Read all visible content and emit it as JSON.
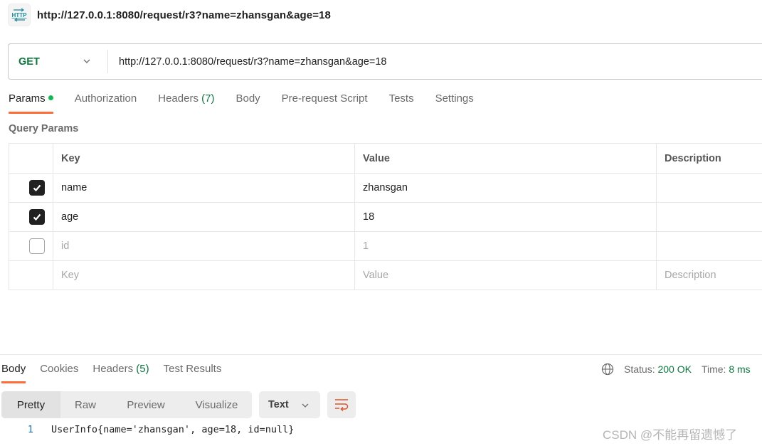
{
  "header": {
    "icon": "http-icon",
    "title": "http://127.0.0.1:8080/request/r3?name=zhansgan&age=18"
  },
  "request": {
    "method": "GET",
    "url": "http://127.0.0.1:8080/request/r3?name=zhansgan&age=18",
    "colors": {
      "method": "#0b7a3e",
      "accent": "#ff6c37"
    }
  },
  "request_tabs": [
    {
      "label": "Params",
      "active": true,
      "indicator": "green-dot"
    },
    {
      "label": "Authorization"
    },
    {
      "label": "Headers",
      "count": "(7)"
    },
    {
      "label": "Body"
    },
    {
      "label": "Pre-request Script"
    },
    {
      "label": "Tests"
    },
    {
      "label": "Settings"
    }
  ],
  "query_params": {
    "section_label": "Query Params",
    "columns": {
      "key": "Key",
      "value": "Value",
      "description": "Description"
    },
    "rows": [
      {
        "checked": true,
        "key": "name",
        "value": "zhansgan",
        "description": ""
      },
      {
        "checked": true,
        "key": "age",
        "value": "18",
        "description": ""
      },
      {
        "checked": false,
        "key": "id",
        "value": "1",
        "description": ""
      }
    ],
    "placeholders": {
      "key": "Key",
      "value": "Value",
      "description": "Description"
    }
  },
  "response_tabs": [
    {
      "label": "Body",
      "active": true
    },
    {
      "label": "Cookies"
    },
    {
      "label": "Headers",
      "count": "(5)"
    },
    {
      "label": "Test Results"
    }
  ],
  "response_status": {
    "icon": "globe-icon",
    "status_label": "Status:",
    "status_value": "200 OK",
    "time_label": "Time:",
    "time_value": "8 ms"
  },
  "view_modes": [
    {
      "label": "Pretty",
      "active": true
    },
    {
      "label": "Raw"
    },
    {
      "label": "Preview"
    },
    {
      "label": "Visualize"
    }
  ],
  "format_select": {
    "selected": "Text"
  },
  "wrap_button": {
    "icon": "wrap-lines-icon"
  },
  "response_body": {
    "lines": [
      {
        "number": "1",
        "code": "UserInfo{name='zhansgan', age=18, id=null}"
      }
    ]
  },
  "watermark": "CSDN @不能再留遗憾了"
}
